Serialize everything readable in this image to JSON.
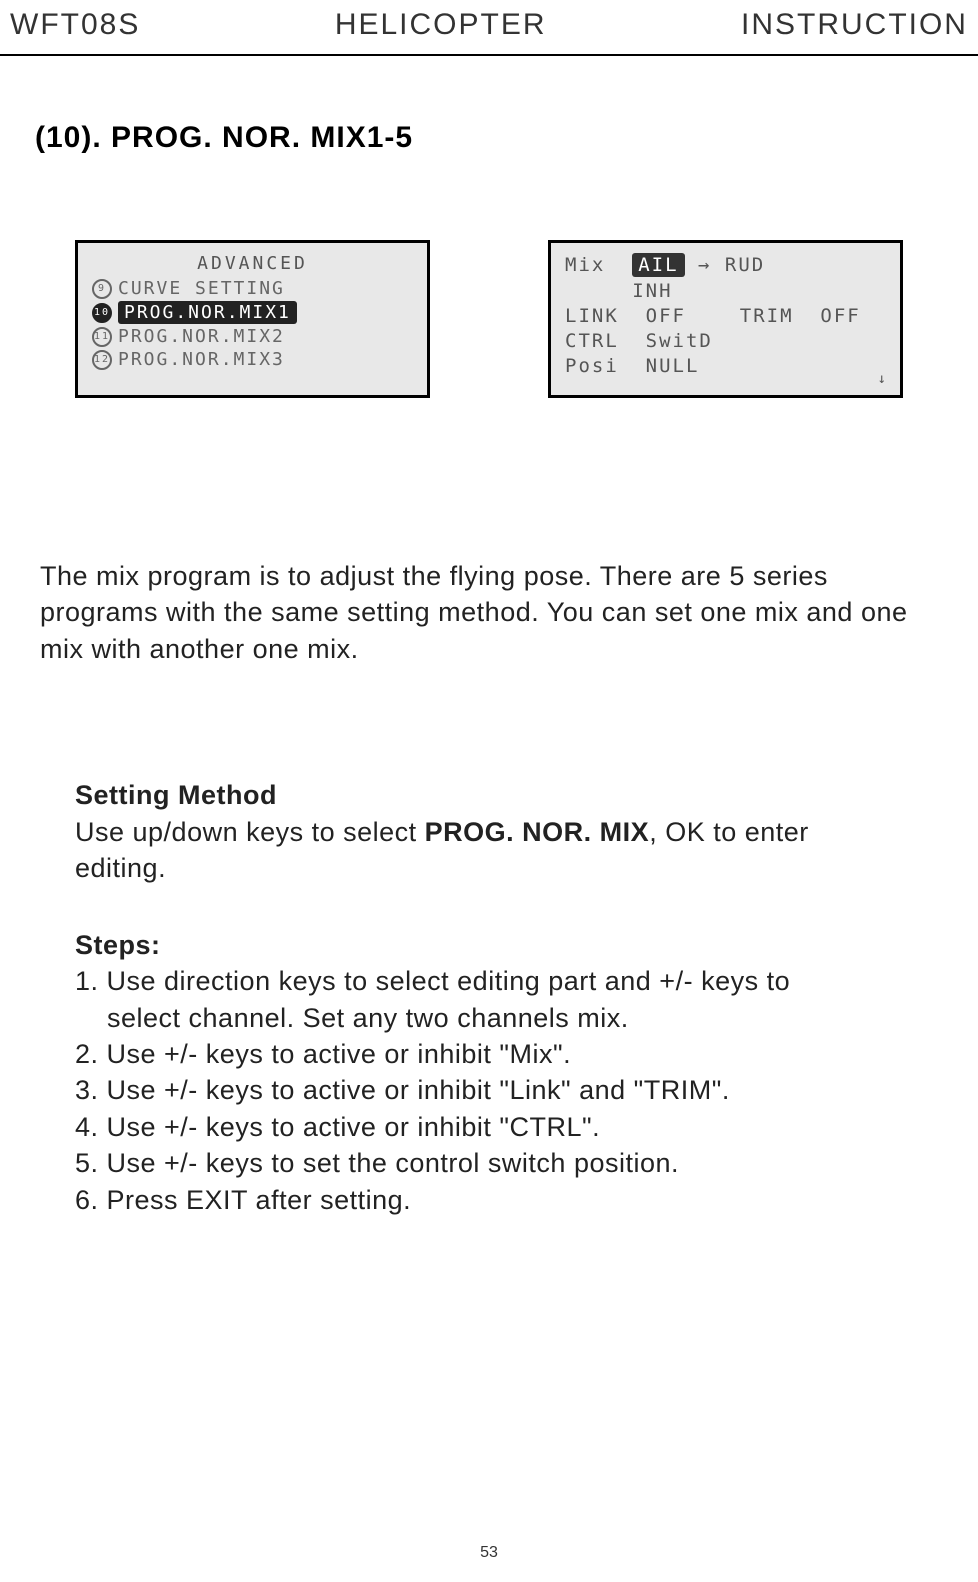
{
  "header": {
    "left": "WFT08S",
    "center": "HELICOPTER",
    "right": "INSTRUCTION"
  },
  "section_title": "(10). PROG. NOR. MIX1-5",
  "screen1": {
    "title": "ADVANCED",
    "items": [
      {
        "num": "9",
        "label": "CURVE SETTING",
        "selected": false
      },
      {
        "num": "10",
        "label": "PROG.NOR.MIX1",
        "selected": true
      },
      {
        "num": "11",
        "label": "PROG.NOR.MIX2",
        "selected": false
      },
      {
        "num": "12",
        "label": "PROG.NOR.MIX3",
        "selected": false
      }
    ]
  },
  "screen2": {
    "mix_label": "Mix",
    "mix_from": "AIL",
    "mix_arrow": "→",
    "mix_to": "RUD",
    "inh": "INH",
    "link_label": "LINK",
    "link_val": "OFF",
    "trim_label": "TRIM",
    "trim_val": "OFF",
    "ctrl_label": "CTRL",
    "ctrl_val": "SwitD",
    "posi_label": "Posi",
    "posi_val": "NULL"
  },
  "description": "The mix program is to adjust the flying pose. There are 5 series programs with the same setting method. You can set one mix and one mix with another one mix.",
  "setting_method": {
    "heading": "Setting Method",
    "text_before": "Use up/down keys to select ",
    "bold_term": "PROG. NOR. MIX",
    "text_after": ", OK to enter editing."
  },
  "steps": {
    "heading": "Steps:",
    "items": [
      "1. Use direction keys to select editing part and +/- keys to",
      "    select channel. Set any two channels mix.",
      "2. Use +/- keys to active or  inhibit \"Mix\".",
      "3. Use +/- keys to active or inhibit \"Link\" and \"TRIM\".",
      "4. Use +/- keys to active or inhibit  \"CTRL\".",
      "5. Use +/- keys to set the control switch position.",
      "6. Press EXIT after setting."
    ]
  },
  "page_number": "53"
}
